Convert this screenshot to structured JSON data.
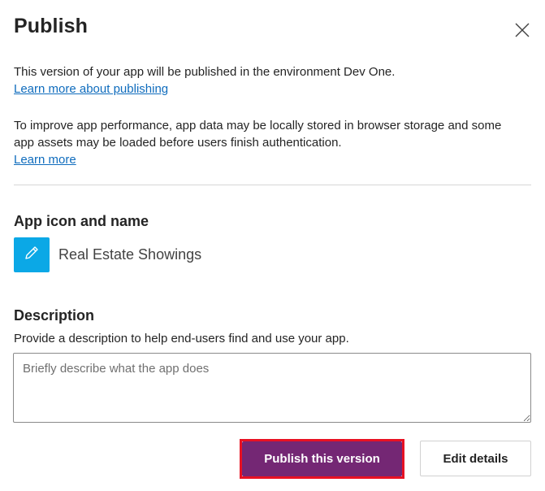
{
  "dialog": {
    "title": "Publish",
    "close_icon": "close-icon"
  },
  "info": {
    "publish_text": "This version of your app will be published in the environment Dev One.",
    "publish_link": "Learn more about publishing",
    "performance_text": "To improve app performance, app data may be locally stored in browser storage and some app assets may be loaded before users finish authentication.",
    "performance_link": "Learn more"
  },
  "app": {
    "section_title": "App icon and name",
    "icon": "pencil-icon",
    "icon_bg_color": "#0ba8e6",
    "name": "Real Estate Showings"
  },
  "description": {
    "section_title": "Description",
    "help_text": "Provide a description to help end-users find and use your app.",
    "placeholder": "Briefly describe what the app does",
    "value": ""
  },
  "actions": {
    "publish_label": "Publish this version",
    "publish_color": "#742774",
    "edit_label": "Edit details",
    "highlight_color": "#e81123"
  }
}
